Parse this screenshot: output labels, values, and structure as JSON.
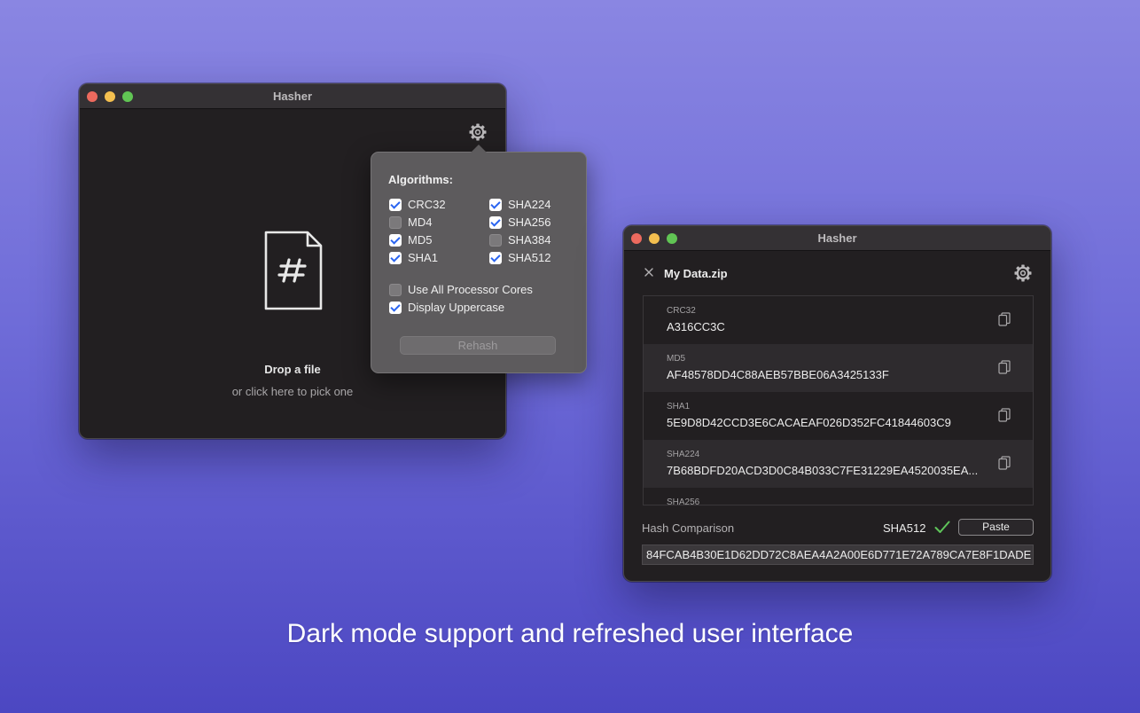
{
  "window1": {
    "title": "Hasher",
    "drop_title": "Drop a file",
    "drop_subtitle": "or click here to pick one",
    "file_icon_glyph": "#"
  },
  "popover": {
    "title": "Algorithms:",
    "algorithms": [
      {
        "label": "CRC32",
        "checked": true
      },
      {
        "label": "MD4",
        "checked": false
      },
      {
        "label": "MD5",
        "checked": true
      },
      {
        "label": "SHA1",
        "checked": true
      },
      {
        "label": "SHA224",
        "checked": true
      },
      {
        "label": "SHA256",
        "checked": true
      },
      {
        "label": "SHA384",
        "checked": false
      },
      {
        "label": "SHA512",
        "checked": true
      }
    ],
    "options": [
      {
        "label": "Use All Processor Cores",
        "checked": false
      },
      {
        "label": "Display Uppercase",
        "checked": true
      }
    ],
    "rehash_label": "Rehash"
  },
  "window2": {
    "title": "Hasher",
    "file_name": "My Data.zip",
    "hashes": [
      {
        "algorithm": "CRC32",
        "value": "A316CC3C"
      },
      {
        "algorithm": "MD5",
        "value": "AF48578DD4C88AEB57BBE06A3425133F"
      },
      {
        "algorithm": "SHA1",
        "value": "5E9D8D42CCD3E6CACAEAF026D352FC41844603C9"
      },
      {
        "algorithm": "SHA224",
        "value": "7B68BDFD20ACD3D0C84B033C7FE31229EA4520035EA..."
      },
      {
        "algorithm": "SHA256",
        "value": ""
      }
    ],
    "comparison": {
      "label": "Hash Comparison",
      "matched_algorithm": "SHA512",
      "paste_label": "Paste",
      "value": "84FCAB4B30E1D62DD72C8AEA4A2A00E6D771E72A789CA7E8F1DADE"
    }
  },
  "caption": "Dark mode support and refreshed user interface",
  "colors": {
    "checkbox_accent": "#2a64f0",
    "match_check": "#5fc55a",
    "traffic_close": "#ed6a5e",
    "traffic_minimize": "#f4bf4f",
    "traffic_maximize": "#61c554"
  }
}
